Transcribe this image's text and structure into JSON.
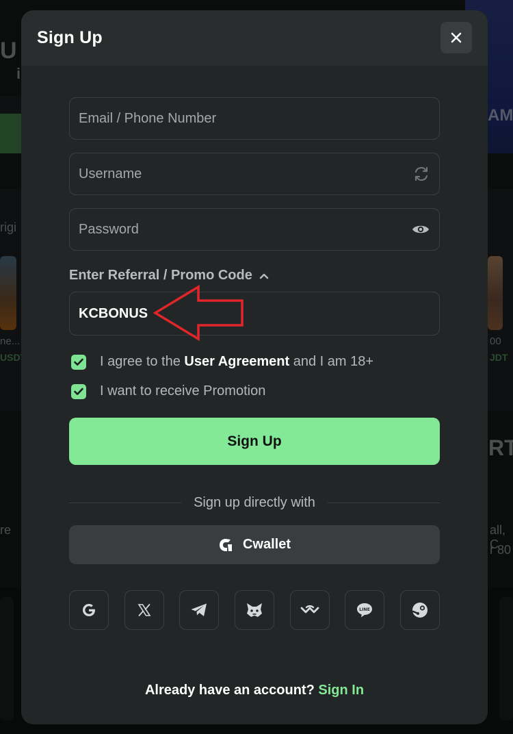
{
  "background": {
    "left_fragments": [
      "U",
      "i",
      "rigi",
      "ne...",
      "USDT",
      "re"
    ],
    "right_fragments": [
      "AME",
      "00",
      "JDT",
      "RTS",
      "all, C",
      "r 80"
    ]
  },
  "modal": {
    "title": "Sign Up",
    "close_icon": "close-icon"
  },
  "form": {
    "email_placeholder": "Email / Phone Number",
    "username_placeholder": "Username",
    "password_placeholder": "Password",
    "promo_toggle_label": "Enter Referral / Promo Code",
    "promo_value": "KCBONUS",
    "agree_prefix": "I agree to the ",
    "agree_link": "User Agreement",
    "agree_suffix": " and I am 18+",
    "promo_opt_in": "I want to receive Promotion",
    "submit_label": "Sign Up"
  },
  "social": {
    "divider_text": "Sign up directly with",
    "cwallet_label": "Cwallet",
    "icons": [
      "google-icon",
      "x-icon",
      "telegram-icon",
      "metamask-icon",
      "walletconnect-icon",
      "line-icon",
      "steam-icon"
    ]
  },
  "footer": {
    "question": "Already have an account?",
    "signin_label": "Sign In"
  },
  "colors": {
    "accent": "#83e996",
    "modal_bg": "#232626",
    "header_bg": "#2a2d2e",
    "annotation_arrow": "#e0262b"
  }
}
